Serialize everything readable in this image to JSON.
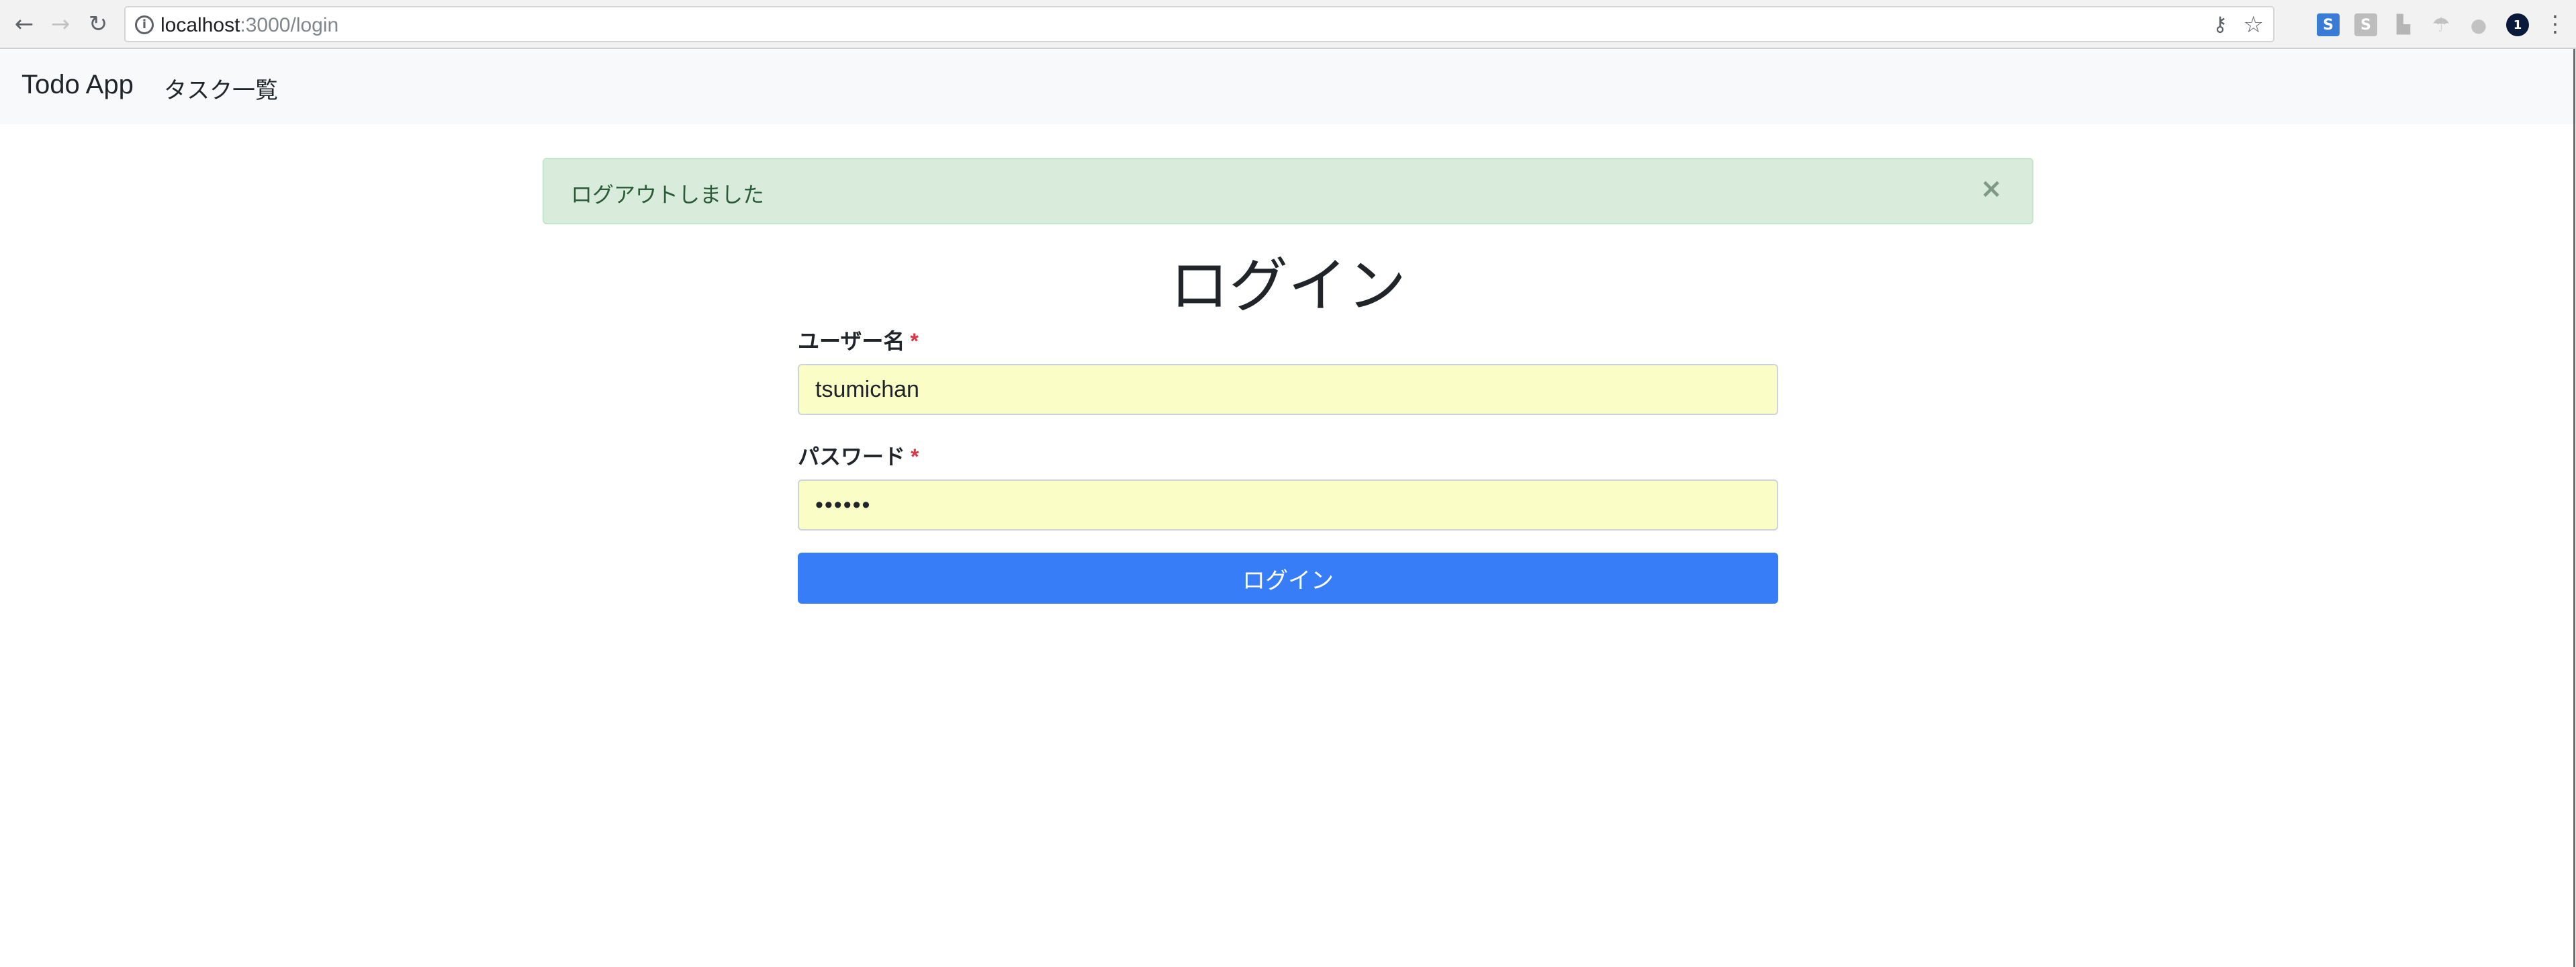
{
  "browser": {
    "url_host": "localhost",
    "url_path": ":3000/login",
    "extension_badge": "1"
  },
  "navbar": {
    "brand": "Todo App",
    "links": [
      {
        "label": "タスク一覧"
      }
    ]
  },
  "alert": {
    "message": "ログアウトしました",
    "close_label": "×",
    "type": "success",
    "color": "#d4edda"
  },
  "form": {
    "title": "ログイン",
    "username": {
      "label": "ユーザー名",
      "required_mark": "*",
      "value": "tsumichan"
    },
    "password": {
      "label": "パスワード",
      "required_mark": "*",
      "value": "••••••"
    },
    "submit_label": "ログイン",
    "accent_color": "#377df7"
  }
}
